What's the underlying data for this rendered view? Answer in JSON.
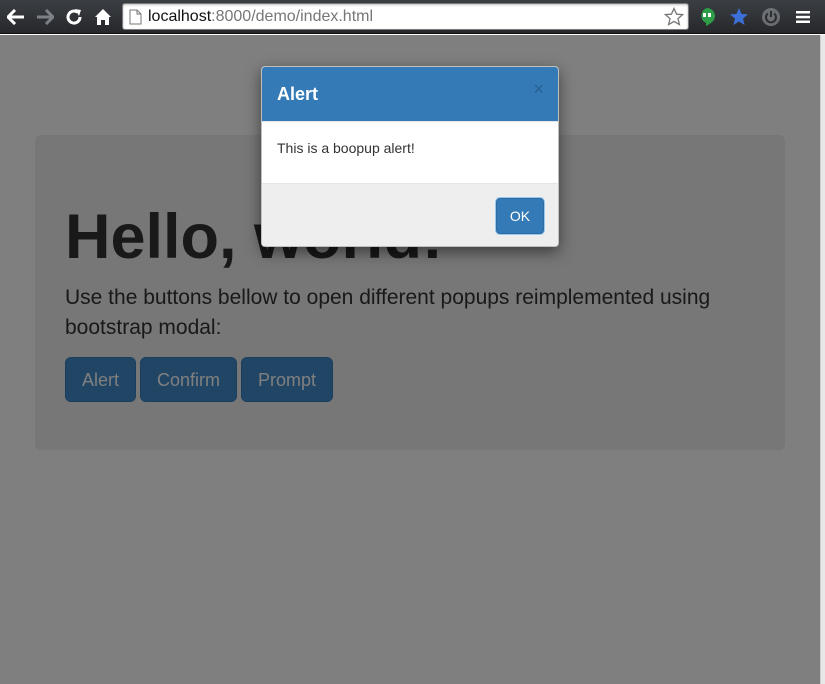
{
  "browser": {
    "url_host": "localhost",
    "url_rest": ":8000/demo/index.html",
    "icons": [
      "back-arrow-icon",
      "forward-arrow-icon",
      "reload-icon",
      "home-icon",
      "page-icon",
      "bookmark-star-icon",
      "hangouts-icon",
      "bookmarks-icon",
      "power-icon",
      "menu-icon"
    ]
  },
  "page": {
    "title": "Hello, world!",
    "lead": "Use the buttons bellow to open different popups reimplemented using bootstrap modal:",
    "buttons": {
      "alert": "Alert",
      "confirm": "Confirm",
      "prompt": "Prompt"
    }
  },
  "modal": {
    "title": "Alert",
    "close": "×",
    "body": "This is a boopup alert!",
    "ok": "OK"
  },
  "colors": {
    "modal_header": "#337ab7",
    "primary_button": "#428bca",
    "jumbotron": "#eeeeee"
  }
}
